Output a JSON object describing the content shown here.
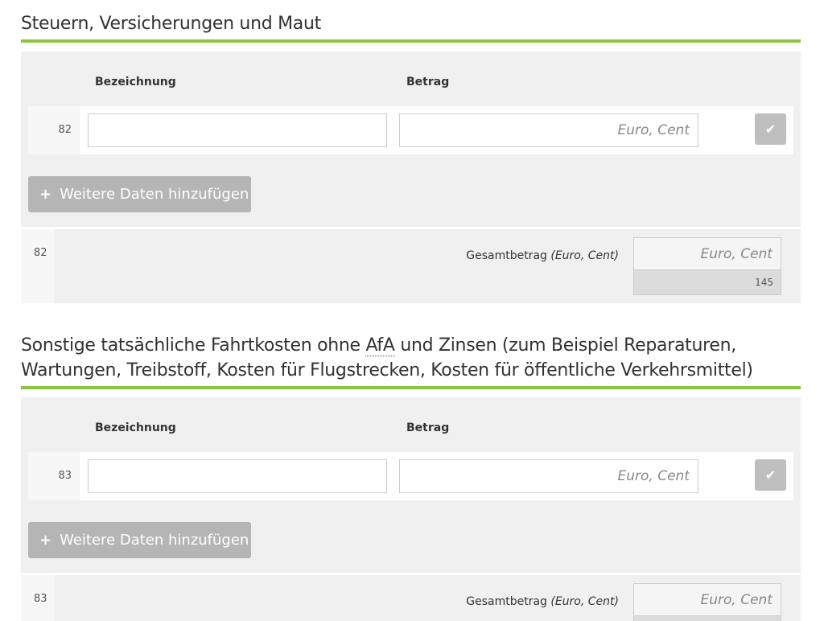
{
  "sections": [
    {
      "title": "Steuern, Versicherungen und Maut",
      "col_name": "Bezeichnung",
      "col_amount": "Betrag",
      "row_number": "82",
      "name_value": "",
      "amount_placeholder": "Euro, Cent",
      "add_label": "Weitere Daten hinzufügen",
      "total_number": "82",
      "total_label": "Gesamtbetrag",
      "total_unit": "(Euro, Cent)",
      "total_placeholder": "Euro, Cent",
      "code": "145"
    },
    {
      "title_before": "Sonstige tatsächliche Fahrtkosten ohne ",
      "title_abbr": "AfA",
      "title_after": " und Zinsen (zum Beispiel Reparaturen, Wartungen, Treibstoff, Kosten für Flugstrecken, Kosten für öffentliche Verkehrsmittel)",
      "col_name": "Bezeichnung",
      "col_amount": "Betrag",
      "row_number": "83",
      "name_value": "",
      "amount_placeholder": "Euro, Cent",
      "add_label": "Weitere Daten hinzufügen",
      "total_number": "83",
      "total_label": "Gesamtbetrag",
      "total_unit": "(Euro, Cent)",
      "total_placeholder": "Euro, Cent"
    }
  ],
  "icons": {
    "check": "checkmark-icon",
    "plus": "plus-icon"
  },
  "colors": {
    "accent_rule": "#8cc63f",
    "panel_bg": "#f0f0f0",
    "button_bg": "#b5b5b5"
  }
}
